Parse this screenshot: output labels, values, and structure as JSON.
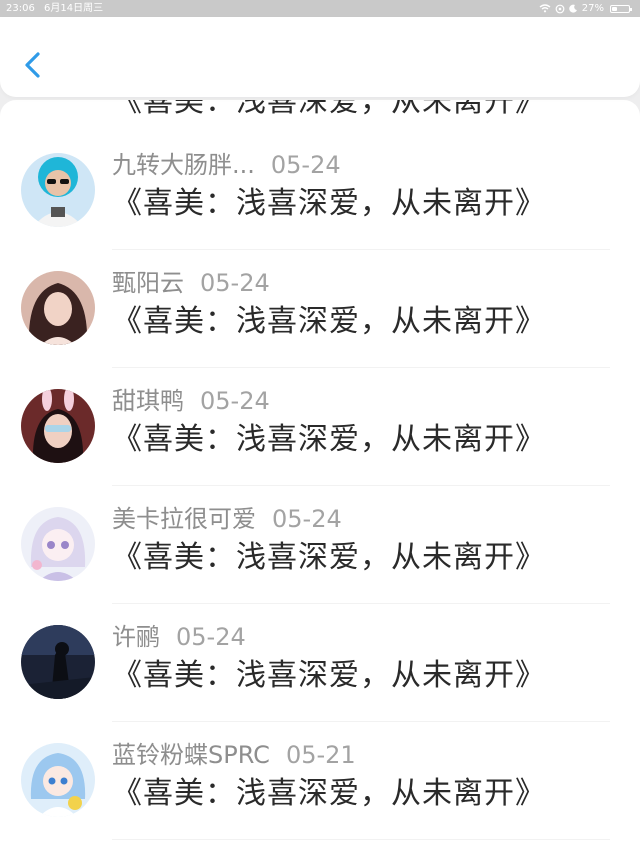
{
  "status_bar": {
    "time": "23:06",
    "date": "6月14日周三",
    "battery": "27%"
  },
  "nav": {
    "back_icon": "chevron-left-icon",
    "accent": "#2f9be8"
  },
  "partial_item": {
    "title": "《喜美：浅喜深爱，从未离开》"
  },
  "items": [
    {
      "name": "九转大肠胖...",
      "date": "05-24",
      "title": "《喜美：浅喜深爱，从未离开》"
    },
    {
      "name": "甄阳云",
      "date": "05-24",
      "title": "《喜美：浅喜深爱，从未离开》"
    },
    {
      "name": "甜琪鸭",
      "date": "05-24",
      "title": "《喜美：浅喜深爱，从未离开》"
    },
    {
      "name": "美卡拉很可爱",
      "date": "05-24",
      "title": "《喜美：浅喜深爱，从未离开》"
    },
    {
      "name": "许鹂",
      "date": "05-24",
      "title": "《喜美：浅喜深爱，从未离开》"
    },
    {
      "name": "蓝铃粉蝶SPRC",
      "date": "05-21",
      "title": "《喜美：浅喜深爱，从未离开》"
    }
  ]
}
